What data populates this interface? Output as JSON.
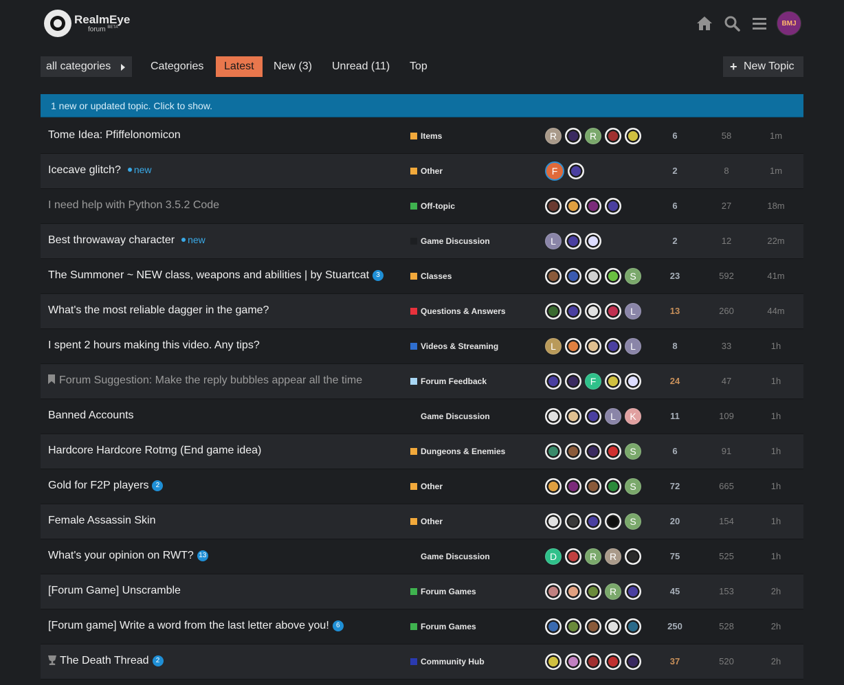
{
  "logo": {
    "title": "RealmEye",
    "sub": "forum",
    "sub_tag": "BETA"
  },
  "user": {
    "avatar_text": "BMJ"
  },
  "nav": {
    "category_dropdown": "all categories",
    "tabs": [
      "Categories",
      "Latest",
      "New (3)",
      "Unread (11)",
      "Top"
    ],
    "active_tab": "Latest",
    "new_topic": "New Topic"
  },
  "banner": "1 new or updated topic. Click to show.",
  "colors": {
    "accent": "#e9774d",
    "banner": "#0d6fa0",
    "link_new": "#3aa9e6"
  },
  "topics": [
    {
      "title": "Tome Idea: Pfiffelonomicon",
      "category": "Items",
      "cat_color": "#f2a93b",
      "posters": [
        {
          "l": "R",
          "c": "#a99a8a"
        },
        {
          "s": "#3a2a60"
        },
        {
          "l": "R",
          "c": "#7aa86b"
        },
        {
          "s": "#a03030"
        },
        {
          "s": "#d0c040"
        }
      ],
      "replies": "6",
      "views": "58",
      "activity": "1m"
    },
    {
      "title": "Icecave glitch?",
      "new": "new",
      "category": "Other",
      "cat_color": "#f2a93b",
      "posters": [
        {
          "l": "F",
          "c": "#e06a3a",
          "op": true
        },
        {
          "s": "#4a3fa0"
        }
      ],
      "replies": "2",
      "views": "8",
      "activity": "1m"
    },
    {
      "title": "I need help with Python 3.5.2 Code",
      "read": true,
      "category": "Off-topic",
      "cat_color": "#3fb34f",
      "posters": [
        {
          "s": "#6a3a30"
        },
        {
          "s": "#e0a040"
        },
        {
          "s": "#7b2b7a"
        },
        {
          "s": "#4a3fa0"
        }
      ],
      "replies": "6",
      "views": "27",
      "activity": "18m"
    },
    {
      "title": "Best throwaway character",
      "new": "new",
      "category": "Game Discussion",
      "cat_color": "#1d1f22",
      "posters": [
        {
          "l": "L",
          "c": "#8a85a8"
        },
        {
          "s": "#4a3fa0"
        },
        {
          "s": "#dcdcff"
        }
      ],
      "replies": "2",
      "views": "12",
      "activity": "22m"
    },
    {
      "title": "The Summoner ~ NEW class, weapons and abilities | by Stuartcat",
      "badge": "3",
      "category": "Classes",
      "cat_color": "#f2a93b",
      "posters": [
        {
          "s": "#8a5a3a"
        },
        {
          "s": "#3a5ab0"
        },
        {
          "s": "#d0d0d0"
        },
        {
          "s": "#6ac040"
        },
        {
          "l": "S",
          "c": "#7aa86b"
        }
      ],
      "replies": "23",
      "views": "592",
      "activity": "41m"
    },
    {
      "title": "What's the most reliable dagger in the game?",
      "category": "Questions & Answers",
      "cat_color": "#e8323c",
      "posters": [
        {
          "s": "#3a6a30"
        },
        {
          "s": "#4a3fa0"
        },
        {
          "s": "#e0e0e0"
        },
        {
          "s": "#c03050"
        },
        {
          "l": "L",
          "c": "#8a85a8"
        }
      ],
      "replies": "13",
      "hot": true,
      "views": "260",
      "activity": "44m"
    },
    {
      "title": "I spent 2 hours making this video. Any tips?",
      "category": "Videos & Streaming",
      "cat_color": "#2f6fd0",
      "posters": [
        {
          "l": "L",
          "c": "#b99a5a"
        },
        {
          "s": "#e08040"
        },
        {
          "s": "#e0c090"
        },
        {
          "s": "#4a3fa0"
        },
        {
          "l": "L",
          "c": "#8a85a8"
        }
      ],
      "replies": "8",
      "views": "33",
      "activity": "1h"
    },
    {
      "title": "Forum Suggestion: Make the reply bubbles appear all the time",
      "pinned": true,
      "read": true,
      "category": "Forum Feedback",
      "cat_color": "#a9d7f5",
      "posters": [
        {
          "s": "#4a3fa0"
        },
        {
          "s": "#3a2a60"
        },
        {
          "l": "F",
          "c": "#2fc08a"
        },
        {
          "s": "#d0c040"
        },
        {
          "s": "#dcdcff"
        }
      ],
      "replies": "24",
      "hot": true,
      "views": "47",
      "activity": "1h"
    },
    {
      "title": "Banned Accounts",
      "category": "Game Discussion",
      "cat_color": "#1d1f22",
      "posters": [
        {
          "s": "#e0e0e0"
        },
        {
          "s": "#e0c090"
        },
        {
          "s": "#4a3fa0"
        },
        {
          "l": "L",
          "c": "#8a85a8"
        },
        {
          "l": "K",
          "c": "#e0a0a0"
        }
      ],
      "replies": "11",
      "views": "109",
      "activity": "1h"
    },
    {
      "title": "Hardcore Hardcore Rotmg (End game idea)",
      "category": "Dungeons & Enemies",
      "cat_color": "#f2a93b",
      "posters": [
        {
          "s": "#3a8a6a"
        },
        {
          "s": "#8a5a3a"
        },
        {
          "s": "#3a2a60"
        },
        {
          "s": "#d03030"
        },
        {
          "l": "S",
          "c": "#7aa86b"
        }
      ],
      "replies": "6",
      "views": "91",
      "activity": "1h"
    },
    {
      "title": "Gold for F2P players",
      "badge": "2",
      "category": "Other",
      "cat_color": "#f2a93b",
      "posters": [
        {
          "s": "#e0a040"
        },
        {
          "s": "#7b2b7a"
        },
        {
          "s": "#8a5a3a"
        },
        {
          "s": "#2a8a3a"
        },
        {
          "l": "S",
          "c": "#7aa86b"
        }
      ],
      "replies": "72",
      "views": "665",
      "activity": "1h"
    },
    {
      "title": "Female Assassin Skin",
      "category": "Other",
      "cat_color": "#f2a93b",
      "posters": [
        {
          "s": "#e0e0e0"
        },
        {
          "s": "#3a3a3a"
        },
        {
          "s": "#4a3fa0"
        },
        {
          "s": "#101010"
        },
        {
          "l": "S",
          "c": "#7aa86b"
        }
      ],
      "replies": "20",
      "views": "154",
      "activity": "1h"
    },
    {
      "title": "What's your opinion on RWT?",
      "badge": "13",
      "category": "Game Discussion",
      "cat_color": "#1d1f22",
      "posters": [
        {
          "l": "D",
          "c": "#2fc08a"
        },
        {
          "s": "#c04040"
        },
        {
          "l": "R",
          "c": "#7aa86b"
        },
        {
          "l": "R",
          "c": "#a99a8a"
        },
        {
          "s": "#2a2a2a"
        }
      ],
      "replies": "75",
      "views": "525",
      "activity": "1h"
    },
    {
      "title": "[Forum Game] Unscramble",
      "category": "Forum Games",
      "cat_color": "#3fb34f",
      "posters": [
        {
          "s": "#c08080"
        },
        {
          "s": "#e0a080"
        },
        {
          "s": "#6a8a3a"
        },
        {
          "l": "R",
          "c": "#7aa86b"
        },
        {
          "s": "#4a3fa0"
        }
      ],
      "replies": "45",
      "views": "153",
      "activity": "2h"
    },
    {
      "title": "[Forum game] Write a word from the last letter above you!",
      "badge": "6",
      "category": "Forum Games",
      "cat_color": "#3fb34f",
      "posters": [
        {
          "s": "#3a6ab0"
        },
        {
          "s": "#6a8a3a"
        },
        {
          "s": "#8a5a3a"
        },
        {
          "s": "#e0e0e0"
        },
        {
          "s": "#2a6a8a"
        }
      ],
      "replies": "250",
      "views": "528",
      "activity": "2h"
    },
    {
      "title": "The Death Thread",
      "badge": "2",
      "trophy": true,
      "category": "Community Hub",
      "cat_color": "#2a3ab0",
      "posters": [
        {
          "s": "#d0c040"
        },
        {
          "s": "#c080c0"
        },
        {
          "s": "#a03030"
        },
        {
          "s": "#c03030"
        },
        {
          "s": "#3a2a60"
        }
      ],
      "replies": "37",
      "hot": true,
      "views": "520",
      "activity": "2h"
    }
  ]
}
